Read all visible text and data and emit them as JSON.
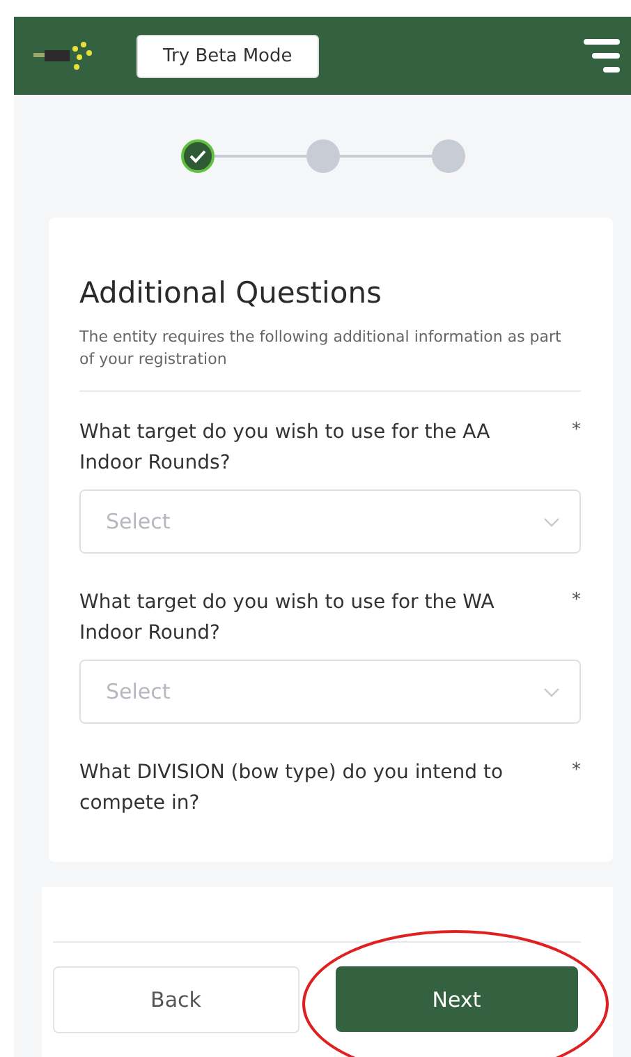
{
  "header": {
    "beta_button": "Try Beta Mode"
  },
  "steps": [
    {
      "completed": true
    },
    {
      "completed": false
    },
    {
      "completed": false
    }
  ],
  "form": {
    "title": "Additional Questions",
    "description": "The entity requires the following additional information as part of your registration",
    "questions": [
      {
        "kind": "select",
        "label": "What target do you wish to use for the AA Indoor Rounds?",
        "required_mark": "*",
        "placeholder": "Select"
      },
      {
        "kind": "select",
        "label": "What target do you wish to use for the WA Indoor Round?",
        "required_mark": "*",
        "placeholder": "Select"
      },
      {
        "kind": "label",
        "label": "What DIVISION (bow type) do you intend to compete in?",
        "required_mark": "*"
      }
    ]
  },
  "footer": {
    "back": "Back",
    "next": "Next",
    "next_highlighted": true
  }
}
